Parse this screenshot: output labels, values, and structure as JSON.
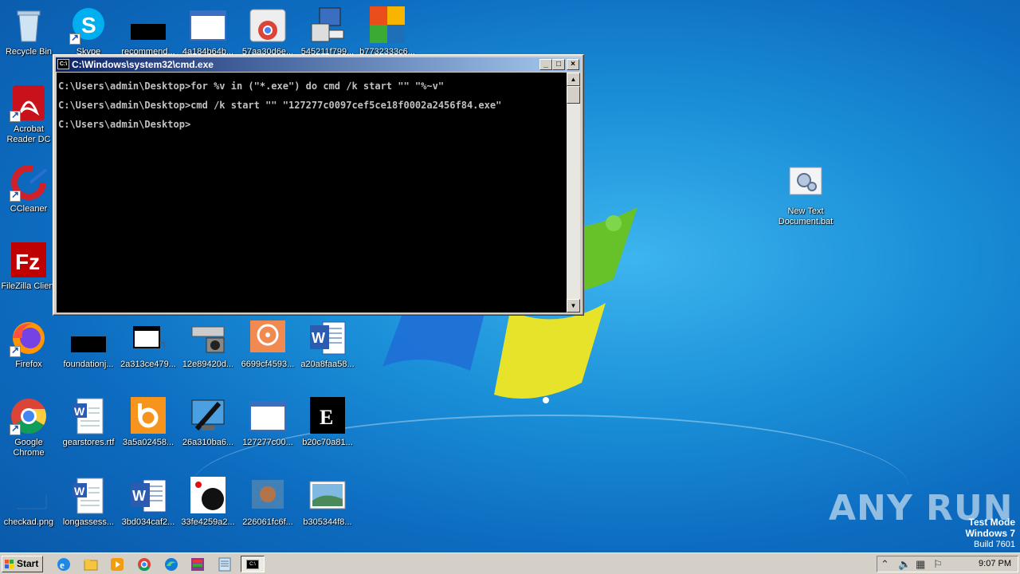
{
  "desktop": {
    "icons": [
      {
        "label": "Recycle Bin",
        "icon": "recycle-bin-icon"
      },
      {
        "label": "Skype",
        "icon": "skype-icon"
      },
      {
        "label": "recommend...",
        "icon": "black-file-icon"
      },
      {
        "label": "4a184b64b...",
        "icon": "window-app-icon"
      },
      {
        "label": "57aa30d6e...",
        "icon": "chrome-installer-icon"
      },
      {
        "label": "545211f799...",
        "icon": "setup-computer-icon"
      },
      {
        "label": "b7732333c6...",
        "icon": "avg-icon"
      },
      {
        "label": "Acrobat Reader DC",
        "icon": "acrobat-icon"
      },
      {
        "label": "CCleaner",
        "icon": "ccleaner-icon"
      },
      {
        "label": "FileZilla Client",
        "icon": "filezilla-icon"
      },
      {
        "label": "Firefox",
        "icon": "firefox-icon"
      },
      {
        "label": "foundationj...",
        "icon": "black-file-icon"
      },
      {
        "label": "2a313ce479...",
        "icon": "film-window-icon"
      },
      {
        "label": "12e89420d...",
        "icon": "scanner-camera-icon"
      },
      {
        "label": "6699cf4593...",
        "icon": "disc-orange-icon"
      },
      {
        "label": "a20a8faa58...",
        "icon": "word-doc-icon"
      },
      {
        "label": "Google Chrome",
        "icon": "chrome-icon"
      },
      {
        "label": "gearstores.rtf",
        "icon": "word-doc-icon"
      },
      {
        "label": "3a5a02458...",
        "icon": "bing-icon"
      },
      {
        "label": "26a310ba6...",
        "icon": "monitor-pen-icon"
      },
      {
        "label": "127277c00...",
        "icon": "window-app-icon"
      },
      {
        "label": "b20c70a81...",
        "icon": "black-f-icon"
      },
      {
        "label": "checkad.png",
        "icon": "blank-image-icon"
      },
      {
        "label": "longassess...",
        "icon": "word-doc-icon"
      },
      {
        "label": "3bd034caf2...",
        "icon": "word-icon"
      },
      {
        "label": "33fe4259a2...",
        "icon": "black-red-icon"
      },
      {
        "label": "226061fc6f...",
        "icon": "blurred-app-icon"
      },
      {
        "label": "b305344f8...",
        "icon": "landscape-image-icon"
      },
      {
        "label": "New Text Document.bat",
        "icon": "bat-gear-icon"
      }
    ]
  },
  "cmd_window": {
    "title": "C:\\Windows\\system32\\cmd.exe",
    "lines": [
      "C:\\Users\\admin\\Desktop>for %v in (\"*.exe\") do cmd /k start \"\" \"%~v\"",
      "C:\\Users\\admin\\Desktop>cmd /k start \"\" \"127277c0097cef5ce18f0002a2456f84.exe\"",
      "C:\\Users\\admin\\Desktop>"
    ],
    "minimize": "_",
    "maximize": "□",
    "close": "×"
  },
  "taskbar": {
    "start_label": "Start",
    "clock": "9:07 PM"
  },
  "watermark": "ANY RUN",
  "testmode": {
    "line1": "Test Mode",
    "line2": "Windows 7",
    "line3": "Build 7601"
  }
}
